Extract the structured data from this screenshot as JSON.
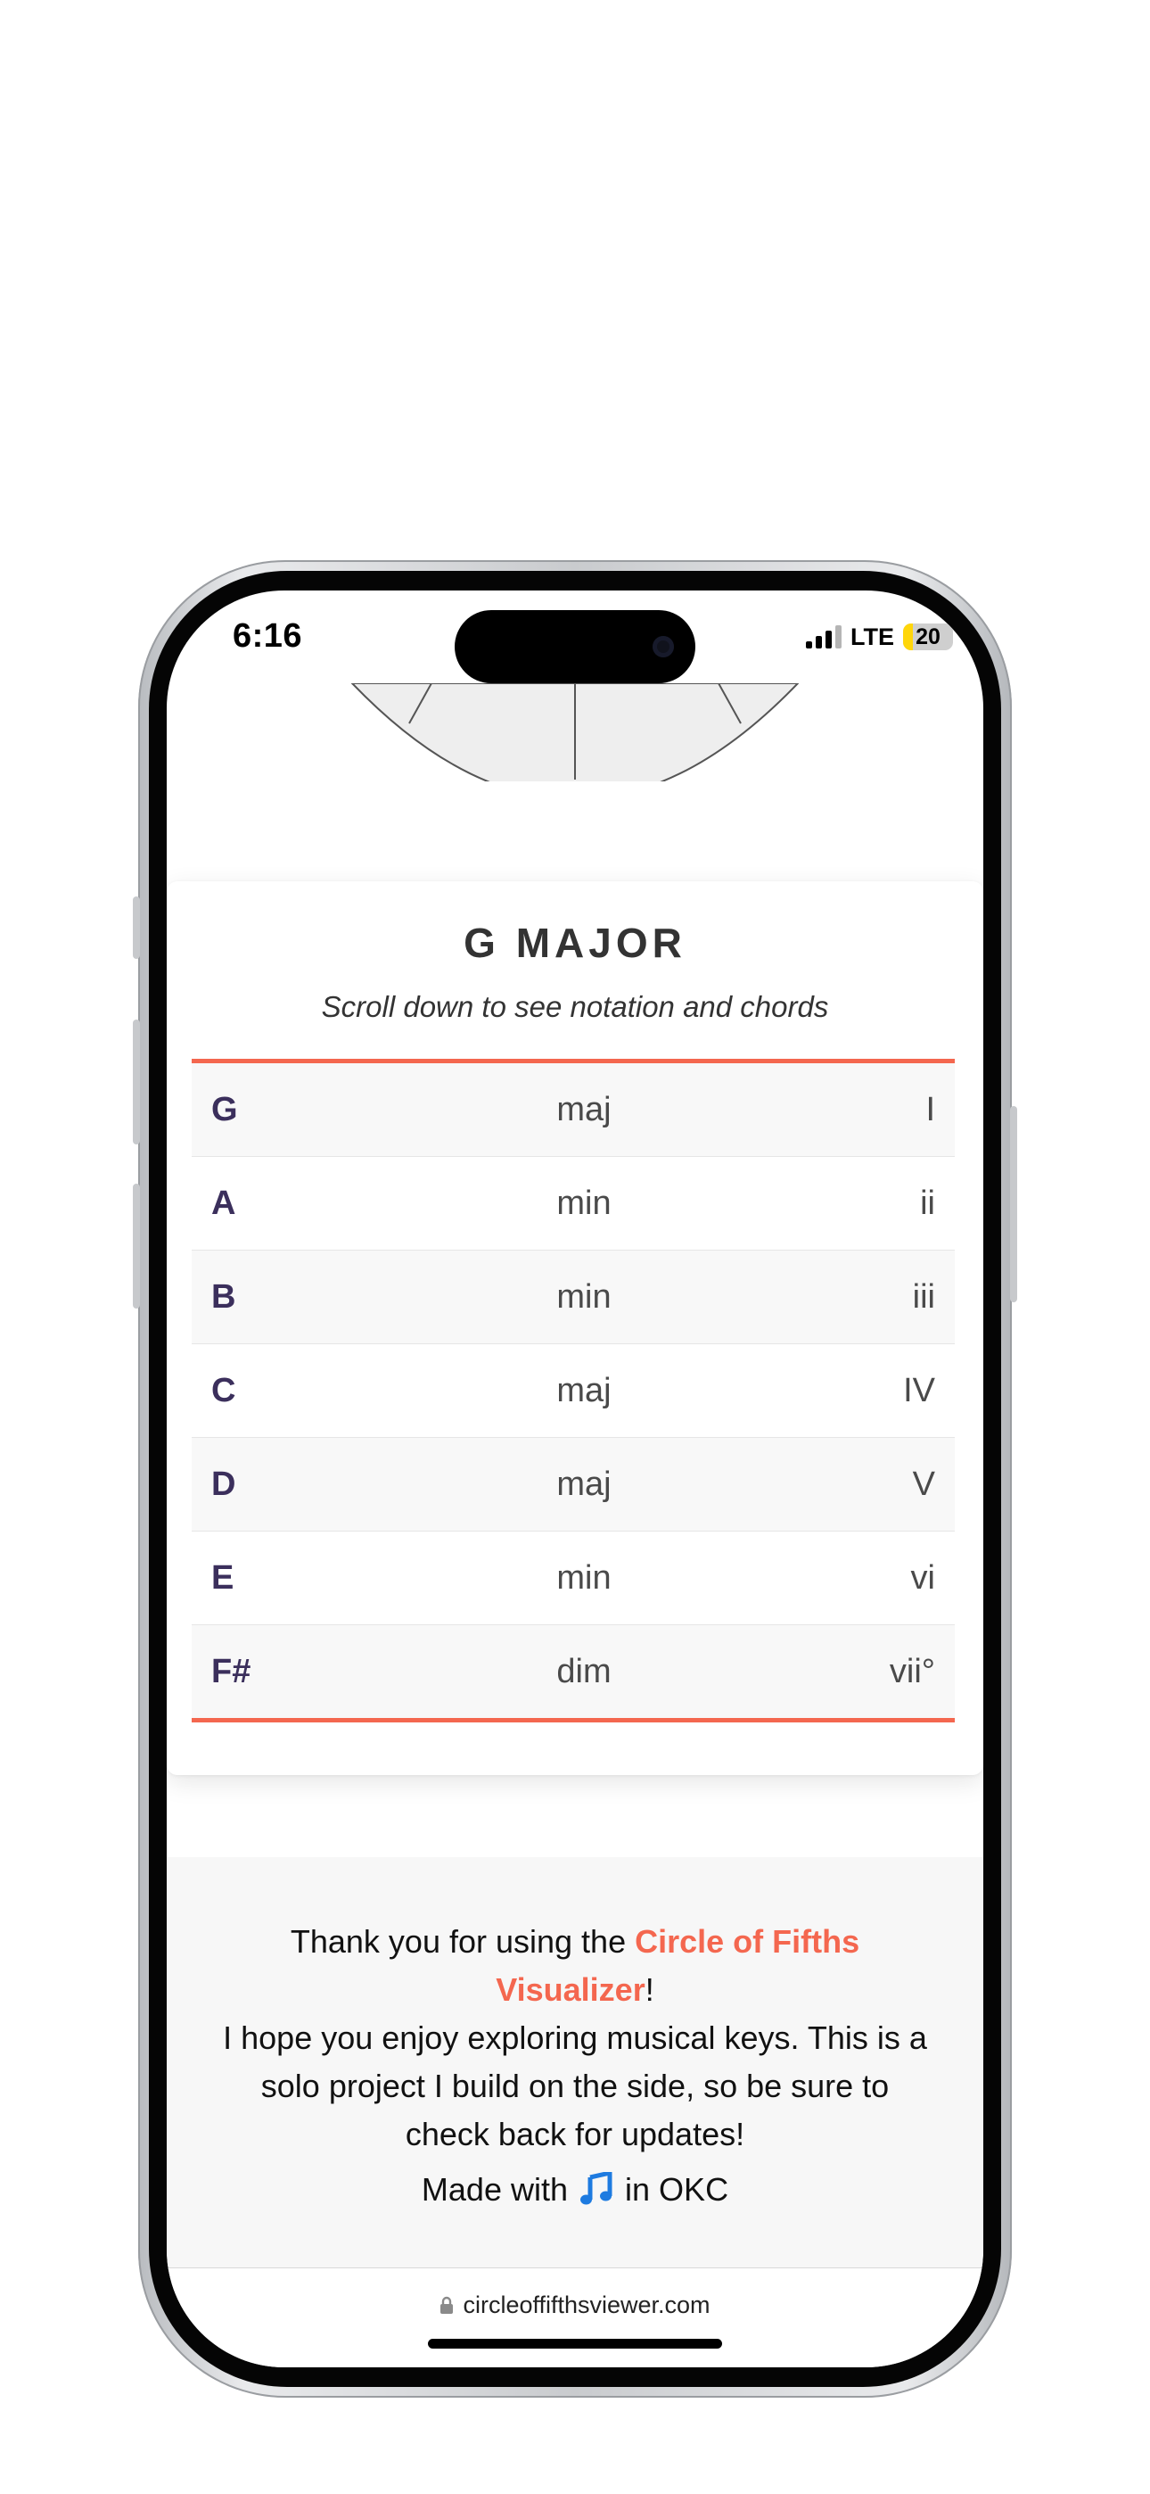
{
  "status_bar": {
    "time": "6:16",
    "network": "LTE",
    "battery_level": "20",
    "signal_bars_active": 3,
    "signal_bars_total": 4
  },
  "key_card": {
    "title": "G MAJOR",
    "subtitle": "Scroll down to see notation and chords",
    "chords": [
      {
        "note": "G",
        "quality": "maj",
        "roman": "I"
      },
      {
        "note": "A",
        "quality": "min",
        "roman": "ii"
      },
      {
        "note": "B",
        "quality": "min",
        "roman": "iii"
      },
      {
        "note": "C",
        "quality": "maj",
        "roman": "IV"
      },
      {
        "note": "D",
        "quality": "maj",
        "roman": "V"
      },
      {
        "note": "E",
        "quality": "min",
        "roman": "vi"
      },
      {
        "note": "F#",
        "quality": "dim",
        "roman": "vii°"
      }
    ]
  },
  "footer": {
    "thanks_prefix": "Thank you for using the ",
    "app_name": "Circle of Fifths Visualizer",
    "thanks_suffix": "!",
    "message": "I hope you enjoy exploring musical keys. This is a solo project I build on the side, so be sure to check back for updates!",
    "made_with_prefix": "Made with",
    "made_with_icon": "music-note-icon",
    "made_with_suffix": "in OKC"
  },
  "browser": {
    "url": "circleoffifthsviewer.com",
    "lock_icon": "lock-icon"
  },
  "colors": {
    "accent": "#f4674f",
    "note_text": "#3b2f5c",
    "music_icon": "#1e7be0"
  }
}
